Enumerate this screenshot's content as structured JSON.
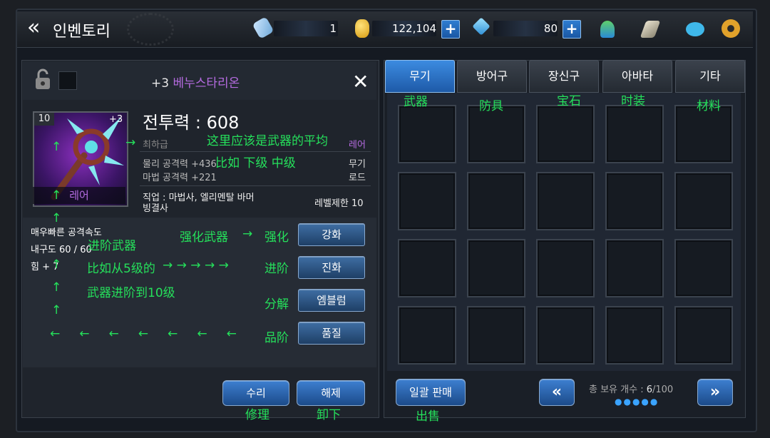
{
  "header": {
    "title": "인벤토리",
    "resources": [
      {
        "name": "stamina",
        "icon": "energy-icon",
        "value": "1"
      },
      {
        "name": "gold",
        "icon": "gold-coin-icon",
        "value": "122,104"
      },
      {
        "name": "gem",
        "icon": "diamond-icon",
        "value": "80"
      }
    ],
    "top_icons": [
      "people-icon",
      "scroll-icon",
      "chat-icon",
      "settings-gear-icon"
    ]
  },
  "item": {
    "name_prefix": "+3",
    "name": "베누스타리온",
    "level": "10",
    "plus": "+3",
    "rarity": "레어",
    "power": "전투력 : 608",
    "grade": "최하급",
    "rarity_right": "레어",
    "phys_atk": "물리 공격력 +436",
    "mag_atk": "마법 공격력 +221",
    "type": "무기",
    "subtype": "로드",
    "job_line1": "직업 : 마법사, 엘리멘탈 바머",
    "job_line2": "빙결사",
    "level_limit": "레벨제한 10",
    "attack_speed": "매우빠른 공격속도",
    "durability": "내구도 60 / 60",
    "strength": "힘 + 7"
  },
  "actions": {
    "enhance": "강화",
    "evolve": "진화",
    "disassemble": "엠블럼",
    "quality": "품질",
    "repair": "수리",
    "unequip": "해제"
  },
  "annotations": {
    "avg_note": "这里应该是武器的平均",
    "grade_note": "比如 下级 中级",
    "advance_weapon": "进阶武器",
    "enhance_weapon": "强化武器",
    "enhance": "强化",
    "example": "比如从5级的",
    "advance": "进阶",
    "to_level10": "武器进阶到10级",
    "disassemble": "分解",
    "quality": "品阶",
    "repair": "修理",
    "unequip": "卸下",
    "weapon": "武器",
    "armor": "防具",
    "gem": "宝石",
    "fashion": "时装",
    "material": "材料",
    "bulk_sell": "出售"
  },
  "tabs": [
    "무기",
    "방어구",
    "장신구",
    "아바타",
    "기타"
  ],
  "inventory": {
    "bulk_sell": "일괄 판매",
    "count_label": "총 보유 개수 :",
    "count_current": "6",
    "count_max": "/100",
    "page_dots": "●●●●●"
  },
  "colors": {
    "accent": "#2e7dd1",
    "rarity": "#b56be0",
    "annotation": "#25e05b"
  }
}
